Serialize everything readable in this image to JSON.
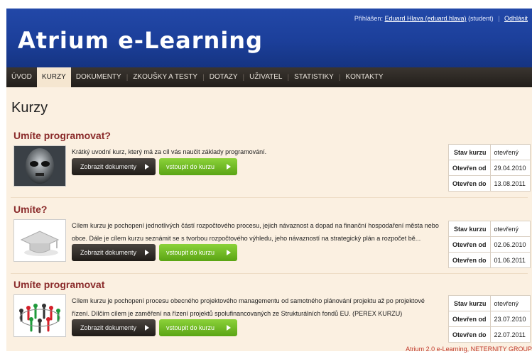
{
  "header": {
    "site_title": "Atrium e-Learning",
    "login_prefix": "Přihlášen:",
    "user_link": "Eduard Hlava (eduard.hlava)",
    "user_role": "(student)",
    "logout": "Odhlásit"
  },
  "nav": {
    "items": [
      "ÚVOD",
      "KURZY",
      "DOKUMENTY",
      "ZKOUŠKY A TESTY",
      "DOTAZY",
      "UŽIVATEL",
      "STATISTIKY",
      "KONTAKTY"
    ],
    "active": "KURZY"
  },
  "page_title": "Kurzy",
  "labels": {
    "show_docs": "Zobrazit dokumenty",
    "enter_course": "vstoupit do kurzu",
    "state": "Stav kurzu",
    "open_from": "Otevřen od",
    "open_to": "Otevřen do"
  },
  "courses": [
    {
      "title": "Umíte programovat?",
      "description": "Krátký uvodní kurz, který má za cíl vás naučit základy programování.",
      "state": "otevřený",
      "open_from": "29.04.2010",
      "open_to": "13.08.2011",
      "thumb_icon": "alien-face-icon"
    },
    {
      "title": "Umíte?",
      "description": "Cílem kurzu je pochopení jednotlivých částí rozpočtového procesu, jejich návaznost a dopad na finanční hospodaření města nebo obce. Dále je cílem kurzu seznámit se s tvorbou rozpočtového výhledu, jeho návazností na strategický plán a rozpočet bě...",
      "state": "otevřený",
      "open_from": "02.06.2010",
      "open_to": "01.06.2011",
      "thumb_icon": "graduation-cap-icon"
    },
    {
      "title": "Umíte programovat",
      "description": "Cílem kurzu je pochopení procesu obecného projektového managementu od samotného plánování projektu až po projektové řízení. Dílčím cílem je zaměření na řízení projektů spolufinancovaných ze Strukturálních fondů EU. (PEREX KURZU)",
      "state": "otevřený",
      "open_from": "23.07.2010",
      "open_to": "22.07.2011",
      "thumb_icon": "people-circle-icon"
    }
  ],
  "footer": "Atrium 2.0 e-Learning, NETERNITY GROUP"
}
